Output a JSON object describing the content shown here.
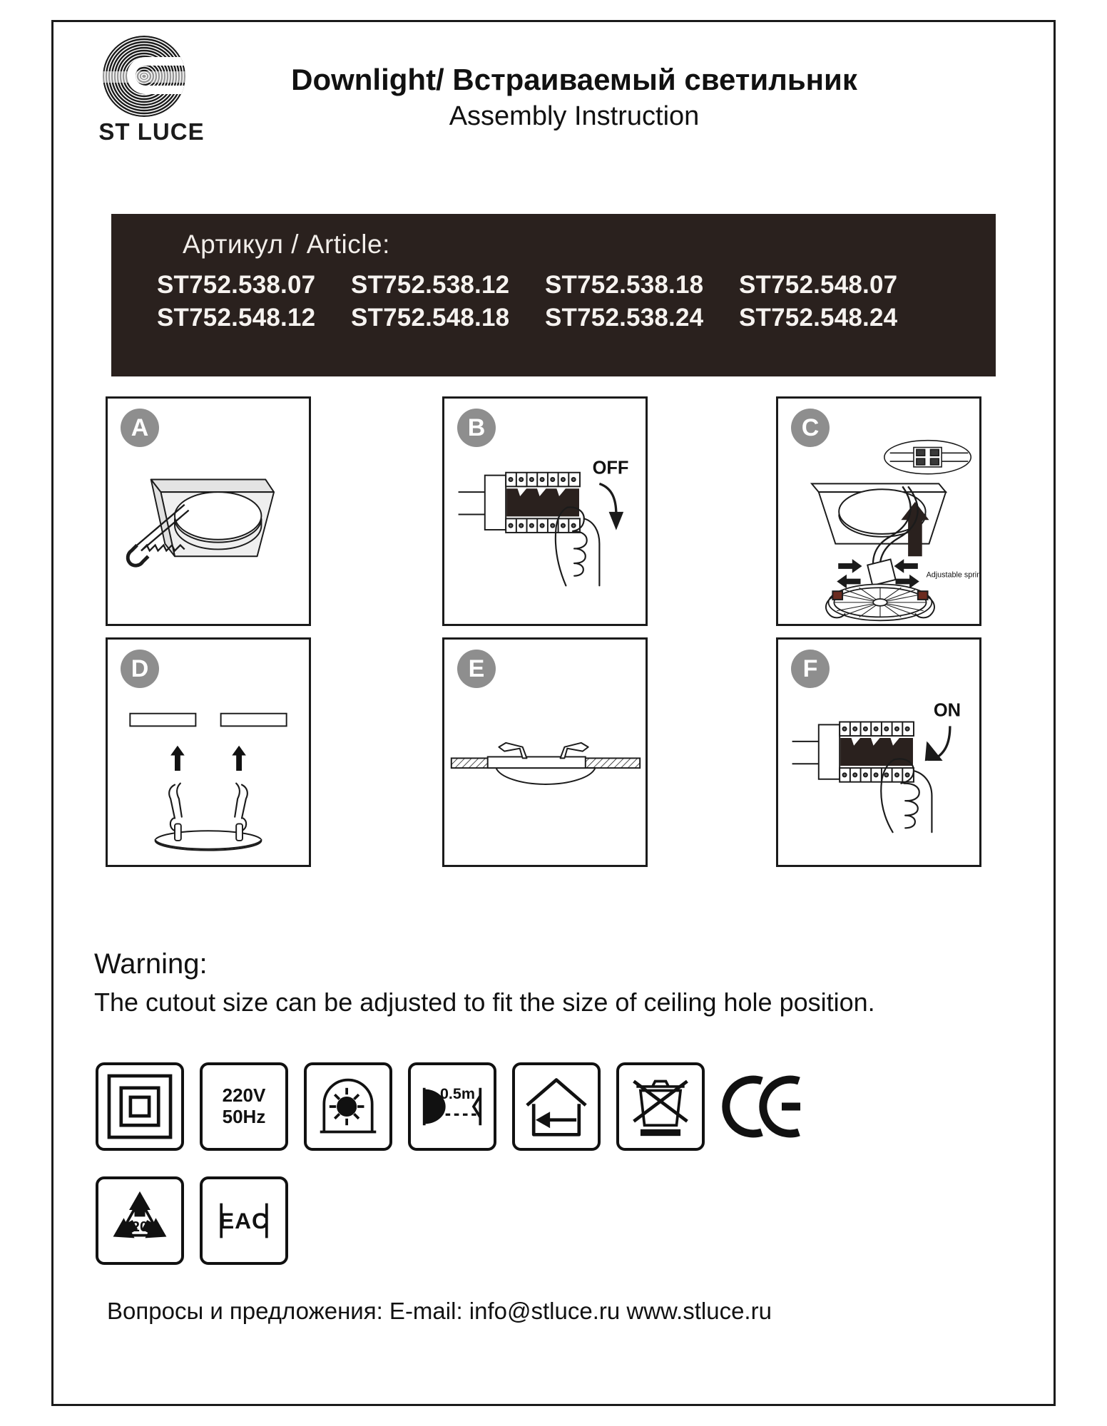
{
  "header": {
    "brand": "ST LUCE",
    "logo_icon": "stluce-spiral-logo",
    "title_main": "Downlight/ Встраиваемый светильник",
    "title_sub": "Assembly Instruction"
  },
  "article": {
    "label": "Артикул / Article:",
    "rows": [
      [
        "ST752.538.07",
        "ST752.538.12",
        "ST752.538.18",
        "ST752.548.07"
      ],
      [
        "ST752.548.12",
        "ST752.548.18",
        "ST752.538.24",
        "ST752.548.24"
      ]
    ]
  },
  "steps": [
    {
      "badge": "A",
      "art": "ceiling-cutout-saw"
    },
    {
      "badge": "B",
      "art": "breaker-switch-off-hand",
      "label": "OFF"
    },
    {
      "badge": "C",
      "art": "insert-fixture-wiring",
      "label": "Adjustable spring"
    },
    {
      "badge": "D",
      "art": "springs-up-to-ceiling"
    },
    {
      "badge": "E",
      "art": "fixture-seated-in-ceiling"
    },
    {
      "badge": "F",
      "art": "breaker-switch-on-hand",
      "label": "ON"
    }
  ],
  "step_labels": {
    "off": "OFF",
    "on": "ON",
    "adjustable_spring": "Adjustable spring"
  },
  "warning": {
    "title": "Warning:",
    "body": "The cutout size can be adjusted to fit the size of ceiling hole position."
  },
  "symbols": {
    "row1": [
      {
        "name": "recessed-luminaire-icon",
        "text": ""
      },
      {
        "name": "voltage-frequency-icon",
        "line1": "220V",
        "line2": "50Hz"
      },
      {
        "name": "lamp-shield-icon",
        "text": ""
      },
      {
        "name": "minimum-distance-icon",
        "text": "0.5m"
      },
      {
        "name": "indoor-use-icon",
        "text": ""
      },
      {
        "name": "weee-crossed-bin-icon",
        "text": ""
      },
      {
        "name": "ce-mark-icon",
        "text": ""
      }
    ],
    "row2": [
      {
        "name": "recycle-icon",
        "text": "20"
      },
      {
        "name": "eac-mark-icon",
        "text": "EAC"
      }
    ]
  },
  "footer": {
    "text": "Вопросы и предложения: E-mail: info@stluce.ru www.stluce.ru"
  },
  "colors": {
    "banner_bg": "#2a211e",
    "banner_text": "#f6f3f0",
    "badge_bg": "#8e8e8e",
    "ink": "#1b1b1b"
  }
}
